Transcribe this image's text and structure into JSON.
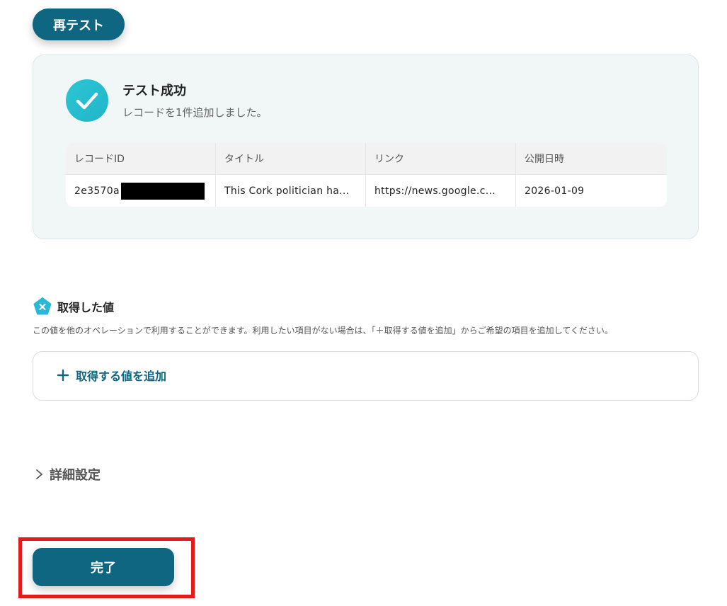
{
  "retest_button": {
    "label": "再テスト"
  },
  "result": {
    "title": "テスト成功",
    "subtitle": "レコードを1件追加しました。",
    "table": {
      "headers": [
        "レコードID",
        "タイトル",
        "リンク",
        "公開日時"
      ],
      "row": [
        "2e3570a",
        "This Cork politician ha...",
        "https://news.google.c...",
        "2026-01-09"
      ]
    }
  },
  "acquired_values": {
    "title": "取得した値",
    "description": "この値を他のオペレーションで利用することができます。利用したい項目がない場合は、「＋取得する値を追加」からご希望の項目を追加してください。",
    "add_label": "取得する値を追加"
  },
  "advanced_settings": {
    "label": "詳細設定"
  },
  "done_button": {
    "label": "完了"
  },
  "colors": {
    "primary": "#0f6680",
    "success": "#1eb6c8",
    "highlight": "#e31b1b"
  },
  "icons": [
    "check-icon",
    "x-badge-icon",
    "plus-icon",
    "chevron-right-icon"
  ]
}
